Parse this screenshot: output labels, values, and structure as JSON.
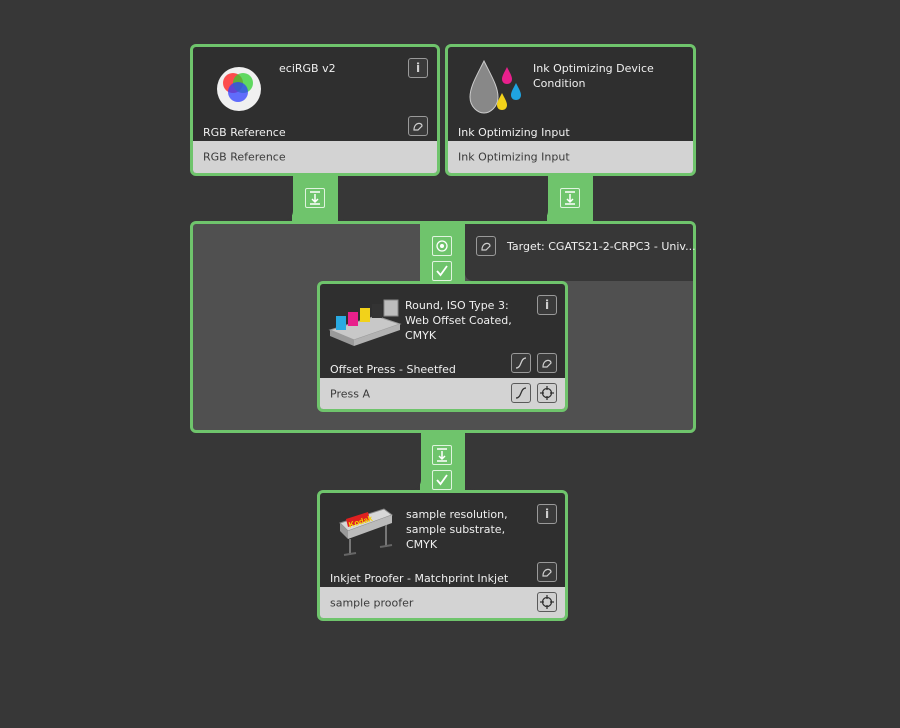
{
  "top_left_card": {
    "title": "eciRGB v2",
    "subtitle": "RGB Reference",
    "footer": "RGB Reference"
  },
  "top_right_card": {
    "title_line1": "Ink Optimizing Device",
    "title_line2": "Condition",
    "subtitle": "Ink Optimizing Input",
    "footer": "Ink Optimizing Input"
  },
  "target_label": "Target: CGATS21-2-CRPC3 - Univ...",
  "press_card": {
    "title_line1": "Round, ISO Type 3:",
    "title_line2": "Web Offset Coated,",
    "title_line3": "CMYK",
    "subtitle": "Offset Press - Sheetfed",
    "footer": "Press A"
  },
  "proofer_card": {
    "title_line1": "sample resolution,",
    "title_line2": "sample substrate,",
    "title_line3": "CMYK",
    "subtitle": "Inkjet Proofer - Matchprint Inkjet",
    "footer": "sample proofer"
  },
  "kodak_logo_text": "Kodak",
  "info_glyph": "i",
  "colors": {
    "accent_green": "#6fc46c",
    "background": "#373737",
    "card_dark": "#2f2f2f",
    "footer_gray": "#d3d3d3"
  }
}
